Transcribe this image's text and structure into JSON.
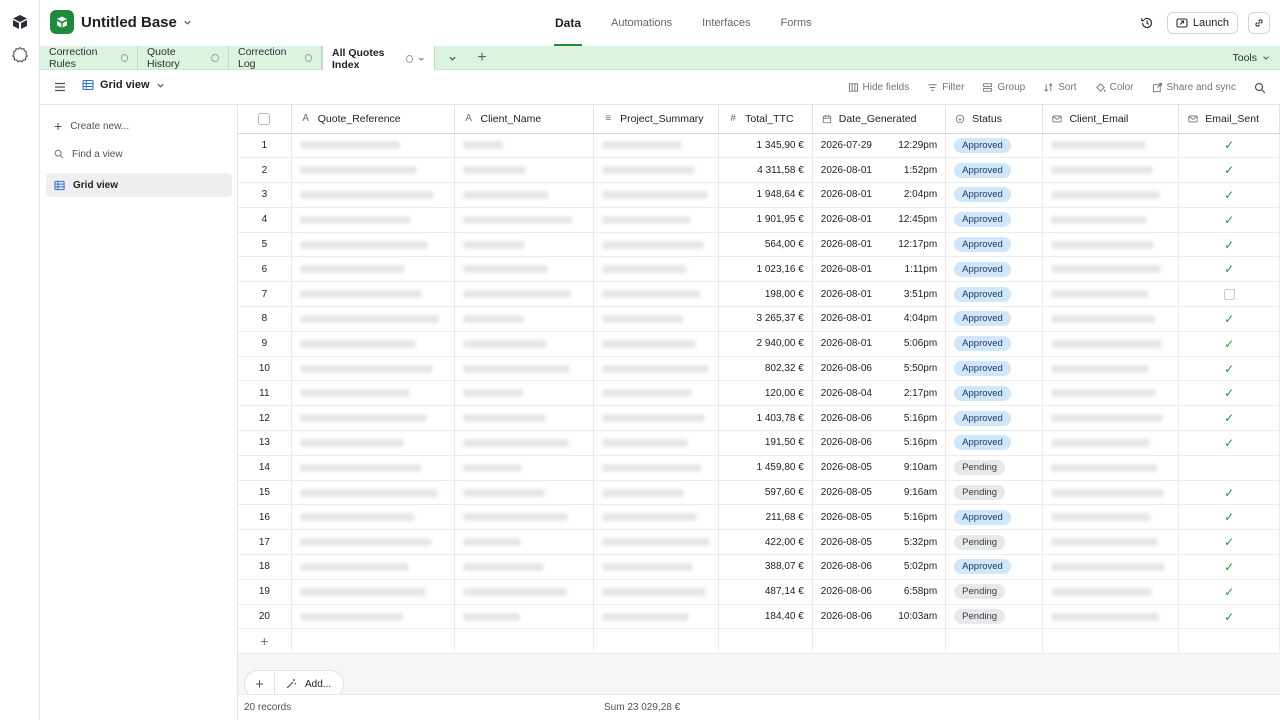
{
  "app": {
    "base_name": "Untitled Base",
    "nav": [
      "Data",
      "Automations",
      "Interfaces",
      "Forms"
    ],
    "launch_label": "Launch"
  },
  "tabs": [
    {
      "label": "Correction Rules"
    },
    {
      "label": "Quote History"
    },
    {
      "label": "Correction Log"
    },
    {
      "label": "All Quotes Index"
    }
  ],
  "tools_label": "Tools",
  "viewbar": {
    "view_name": "Grid view",
    "hide_fields": "Hide fields",
    "filter": "Filter",
    "group": "Group",
    "sort": "Sort",
    "color": "Color",
    "share": "Share and sync"
  },
  "sidebar": {
    "create_new": "Create new...",
    "find_placeholder": "Find a view",
    "views": [
      "Grid view"
    ]
  },
  "columns": [
    "Quote_Reference",
    "Client_Name",
    "Project_Summary",
    "Total_TTC",
    "Date_Generated",
    "Status",
    "Client_Email",
    "Email_Sent"
  ],
  "rows": [
    {
      "n": "1",
      "total": "1 345,90 €",
      "date": "2026-07-29",
      "time": "12:29pm",
      "status": "Approved",
      "sent": true
    },
    {
      "n": "2",
      "total": "4 311,58 €",
      "date": "2026-08-01",
      "time": "1:52pm",
      "status": "Approved",
      "sent": true
    },
    {
      "n": "3",
      "total": "1 948,64 €",
      "date": "2026-08-01",
      "time": "2:04pm",
      "status": "Approved",
      "sent": true
    },
    {
      "n": "4",
      "total": "1 901,95 €",
      "date": "2026-08-01",
      "time": "12:45pm",
      "status": "Approved",
      "sent": true
    },
    {
      "n": "5",
      "total": "564,00 €",
      "date": "2026-08-01",
      "time": "12:17pm",
      "status": "Approved",
      "sent": true
    },
    {
      "n": "6",
      "total": "1 023,16 €",
      "date": "2026-08-01",
      "time": "1:11pm",
      "status": "Approved",
      "sent": true
    },
    {
      "n": "7",
      "total": "198,00 €",
      "date": "2026-08-01",
      "time": "3:51pm",
      "status": "Approved",
      "sent": false
    },
    {
      "n": "8",
      "total": "3 265,37 €",
      "date": "2026-08-01",
      "time": "4:04pm",
      "status": "Approved",
      "sent": true
    },
    {
      "n": "9",
      "total": "2 940,00 €",
      "date": "2026-08-01",
      "time": "5:06pm",
      "status": "Approved",
      "sent": true
    },
    {
      "n": "10",
      "total": "802,32 €",
      "date": "2026-08-06",
      "time": "5:50pm",
      "status": "Approved",
      "sent": true
    },
    {
      "n": "11",
      "total": "120,00 €",
      "date": "2026-08-04",
      "time": "2:17pm",
      "status": "Approved",
      "sent": true
    },
    {
      "n": "12",
      "total": "1 403,78 €",
      "date": "2026-08-06",
      "time": "5:16pm",
      "status": "Approved",
      "sent": true
    },
    {
      "n": "13",
      "total": "191,50 €",
      "date": "2026-08-06",
      "time": "5:16pm",
      "status": "Approved",
      "sent": true
    },
    {
      "n": "14",
      "total": "1 459,80 €",
      "date": "2026-08-05",
      "time": "9:10am",
      "status": "Pending",
      "sent": null
    },
    {
      "n": "15",
      "total": "597,60 €",
      "date": "2026-08-05",
      "time": "9:16am",
      "status": "Pending",
      "sent": true
    },
    {
      "n": "16",
      "total": "211,68 €",
      "date": "2026-08-05",
      "time": "5:16pm",
      "status": "Approved",
      "sent": true
    },
    {
      "n": "17",
      "total": "422,00 €",
      "date": "2026-08-05",
      "time": "5:32pm",
      "status": "Pending",
      "sent": true
    },
    {
      "n": "18",
      "total": "388,07 €",
      "date": "2026-08-06",
      "time": "5:02pm",
      "status": "Approved",
      "sent": true
    },
    {
      "n": "19",
      "total": "487,14 €",
      "date": "2026-08-06",
      "time": "6:58pm",
      "status": "Pending",
      "sent": true
    },
    {
      "n": "20",
      "total": "184,40 €",
      "date": "2026-08-06",
      "time": "10:03am",
      "status": "Pending",
      "sent": true
    }
  ],
  "add_label": "Add...",
  "footer": {
    "records": "20 records",
    "sum": "Sum 23 029,28 €"
  },
  "colors": {
    "brand": "#1f8a3a",
    "tabstrip": "#dcf3df",
    "approved_bg": "#cfe6fb",
    "pending_bg": "#e7e8ea",
    "check": "#1f9b3c"
  }
}
